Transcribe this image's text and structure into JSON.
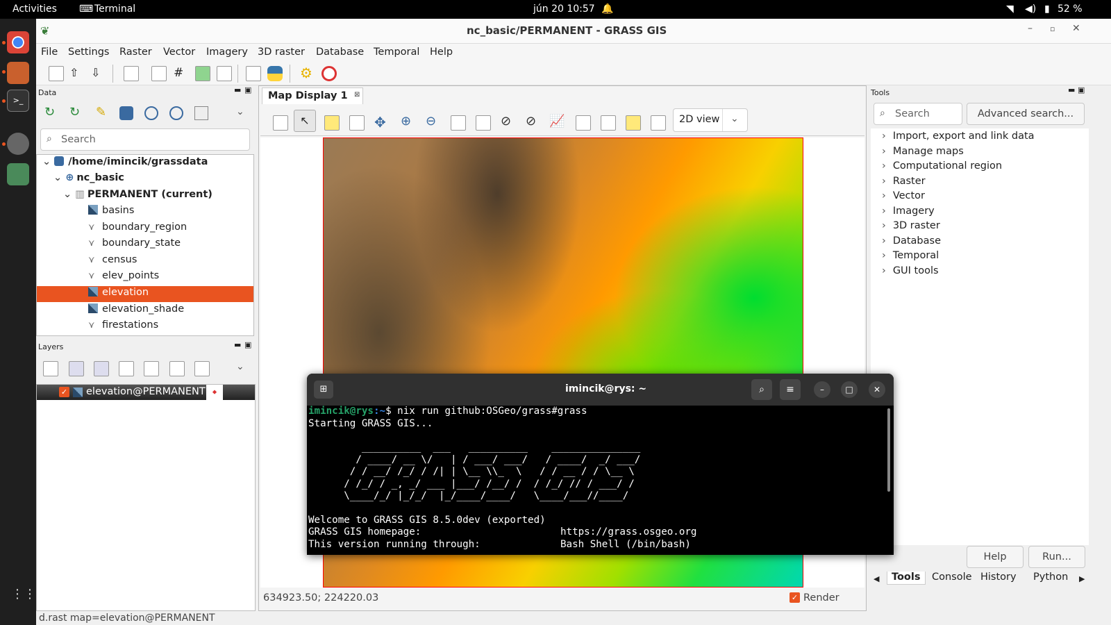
{
  "topbar": {
    "activities": "Activities",
    "app": "Terminal",
    "clock": "jún 20  10:57",
    "battery": "52 %"
  },
  "window": {
    "title": "nc_basic/PERMANENT - GRASS GIS"
  },
  "menu": [
    "File",
    "Settings",
    "Raster",
    "Vector",
    "Imagery",
    "3D raster",
    "Database",
    "Temporal",
    "Help"
  ],
  "data_panel": {
    "title": "Data",
    "search_placeholder": "Search",
    "tree": {
      "grassdb": "/home/imincik/grassdata",
      "location": "nc_basic",
      "mapset": "PERMANENT  (current)",
      "maps": [
        {
          "name": "basins",
          "kind": "raster"
        },
        {
          "name": "boundary_region",
          "kind": "vector"
        },
        {
          "name": "boundary_state",
          "kind": "vector"
        },
        {
          "name": "census",
          "kind": "vector"
        },
        {
          "name": "elev_points",
          "kind": "vector"
        },
        {
          "name": "elevation",
          "kind": "raster",
          "selected": true
        },
        {
          "name": "elevation_shade",
          "kind": "raster"
        },
        {
          "name": "firestations",
          "kind": "vector"
        }
      ]
    }
  },
  "layers_panel": {
    "title": "Layers",
    "layer": "elevation@PERMANENT"
  },
  "map_display": {
    "tab": "Map Display 1",
    "view_mode": "2D view",
    "coords": "634923.50; 224220.03",
    "render_label": "Render"
  },
  "tools_panel": {
    "title": "Tools",
    "search_placeholder": "Search",
    "advanced": "Advanced search...",
    "items": [
      "Import, export and link data",
      "Manage maps",
      "Computational region",
      "Raster",
      "Vector",
      "Imagery",
      "3D raster",
      "Database",
      "Temporal",
      "GUI tools"
    ],
    "help_btn": "Help",
    "run_btn": "Run...",
    "tabs": [
      "Tools",
      "Console",
      "History",
      "Python"
    ]
  },
  "statusbar": {
    "text": "d.rast map=elevation@PERMANENT"
  },
  "terminal": {
    "title": "imincik@rys: ~",
    "prompt_user": "imincik@rys",
    "prompt_path": ":~",
    "prompt_sym": "$ ",
    "command": "nix run github:OSGeo/grass#grass",
    "line2": "Starting GRASS GIS...",
    "art": [
      "         __________  ___   __________    _______________",
      "        / ____/ __ \\/   | / ___/ ___/   / ____/  _/ ___/",
      "       / / __/ /_/ / /| | \\__ \\\\_  \\   / / __ / / \\__ \\",
      "      / /_/ / _, _/ ___ |___/ /__/ /  / /_/ // / ___/ /",
      "      \\____/_/ |_/_/  |_/____/____/   \\____/___//____/"
    ],
    "welcome": "Welcome to GRASS GIS 8.5.0dev (exported)",
    "hp_label": "GRASS GIS homepage:",
    "hp_value": "https://grass.osgeo.org",
    "run_label": "This version running through:",
    "run_value": "Bash Shell (/bin/bash)"
  }
}
